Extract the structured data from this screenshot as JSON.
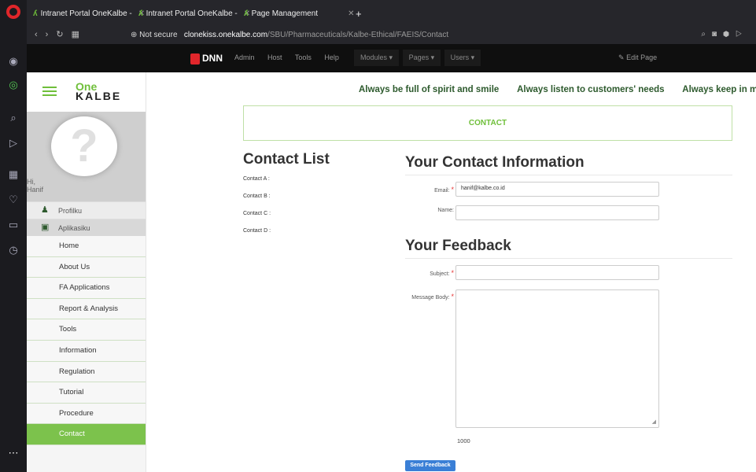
{
  "browser": {
    "tabs": [
      {
        "label": "Intranet Portal OneKalbe -",
        "close": "✕"
      },
      {
        "label": "Intranet Portal OneKalbe -",
        "close": "✕"
      },
      {
        "label": "Page Management",
        "close": "✕"
      }
    ],
    "new_tab": "+",
    "address": {
      "security": "Not secure",
      "host": "clonekiss.onekalbe.com",
      "path": "/SBU/Pharmaceuticals/Kalbe-Ethical/FAEIS/Contact"
    }
  },
  "dnn": {
    "logo": "DNN",
    "menu": [
      "Admin",
      "Host",
      "Tools",
      "Help"
    ],
    "dropdowns": [
      "Modules ▾",
      "Pages ▾",
      "Users ▾"
    ],
    "edit_page": "Edit Page"
  },
  "sidebar": {
    "logo_top": "One",
    "logo_bottom": "KALBE",
    "avatar_symbol": "?",
    "greeting": "Hi,",
    "user_name": "Hanif",
    "profile_items": [
      {
        "label": "Profilku",
        "icon": "user-icon"
      },
      {
        "label": "Aplikasiku",
        "icon": "app-icon"
      }
    ],
    "menu": [
      {
        "label": "Home"
      },
      {
        "label": "About Us"
      },
      {
        "label": "FA Applications"
      },
      {
        "label": "Report & Analysis"
      },
      {
        "label": "Tools"
      },
      {
        "label": "Information"
      },
      {
        "label": "Regulation"
      },
      {
        "label": "Tutorial"
      },
      {
        "label": "Procedure"
      },
      {
        "label": "Contact",
        "active": true
      }
    ]
  },
  "marquee": [
    "Always be full of spirit and smile",
    "Always listen to customers' needs",
    "Always keep in mi"
  ],
  "page": {
    "banner": "CONTACT",
    "contact_list_title": "Contact List",
    "contacts": [
      "Contact A :",
      "Contact B :",
      "Contact C :",
      "Contact D :"
    ],
    "contact_info_title": "Your Contact Information",
    "email_label": "Email:",
    "email_value": "hanif@kalbe.co.id",
    "name_label": "Name:",
    "name_value": "",
    "feedback_title": "Your Feedback",
    "subject_label": "Subject:",
    "subject_value": "",
    "message_label": "Message Body:",
    "message_value": "",
    "char_counter": "1000",
    "send_button": "Send Feedback",
    "required_mark": "*"
  },
  "colors": {
    "accent_green": "#7cc24c",
    "dnn_red": "#e1262b",
    "button_blue": "#3a7fd6"
  }
}
